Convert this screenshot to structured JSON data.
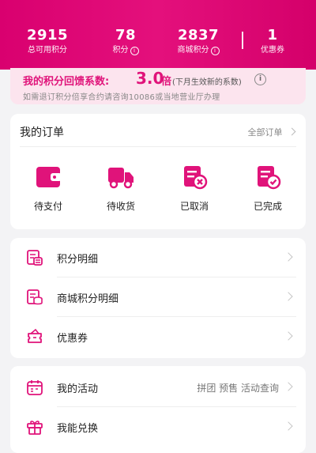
{
  "colors": {
    "accent": "#e0137a",
    "header_start": "#d9006f",
    "header_end": "#d4006a"
  },
  "stats": [
    {
      "value": "2915",
      "label": "总可用积分",
      "info": false
    },
    {
      "value": "78",
      "label": "积分",
      "info": true
    },
    {
      "value": "2837",
      "label": "商城积分",
      "info": true
    },
    {
      "value": "1",
      "label": "优惠券",
      "info": false
    }
  ],
  "coefficient": {
    "title": "我的积分回馈系数:",
    "value": "3.0",
    "unit": "倍",
    "note": "(下月生效新的系数)",
    "info_icon": "i",
    "description": "如需退订积分倍享合约请咨询10086或当地营业厅办理"
  },
  "orders": {
    "title": "我的订单",
    "all_label": "全部订单",
    "items": [
      {
        "label": "待支付",
        "icon": "wallet-icon"
      },
      {
        "label": "待收货",
        "icon": "truck-icon"
      },
      {
        "label": "已取消",
        "icon": "cancel-order-icon"
      },
      {
        "label": "已完成",
        "icon": "completed-order-icon"
      }
    ]
  },
  "menu1": [
    {
      "label": "积分明细",
      "icon": "points-detail-icon"
    },
    {
      "label": "商城积分明细",
      "icon": "mall-points-detail-icon"
    },
    {
      "label": "优惠券",
      "icon": "coupon-icon"
    }
  ],
  "menu2": [
    {
      "label": "我的活动",
      "extra": "拼团 预售 活动查询",
      "icon": "calendar-icon"
    },
    {
      "label": "我能兑换",
      "extra": "",
      "icon": "gift-icon"
    }
  ]
}
